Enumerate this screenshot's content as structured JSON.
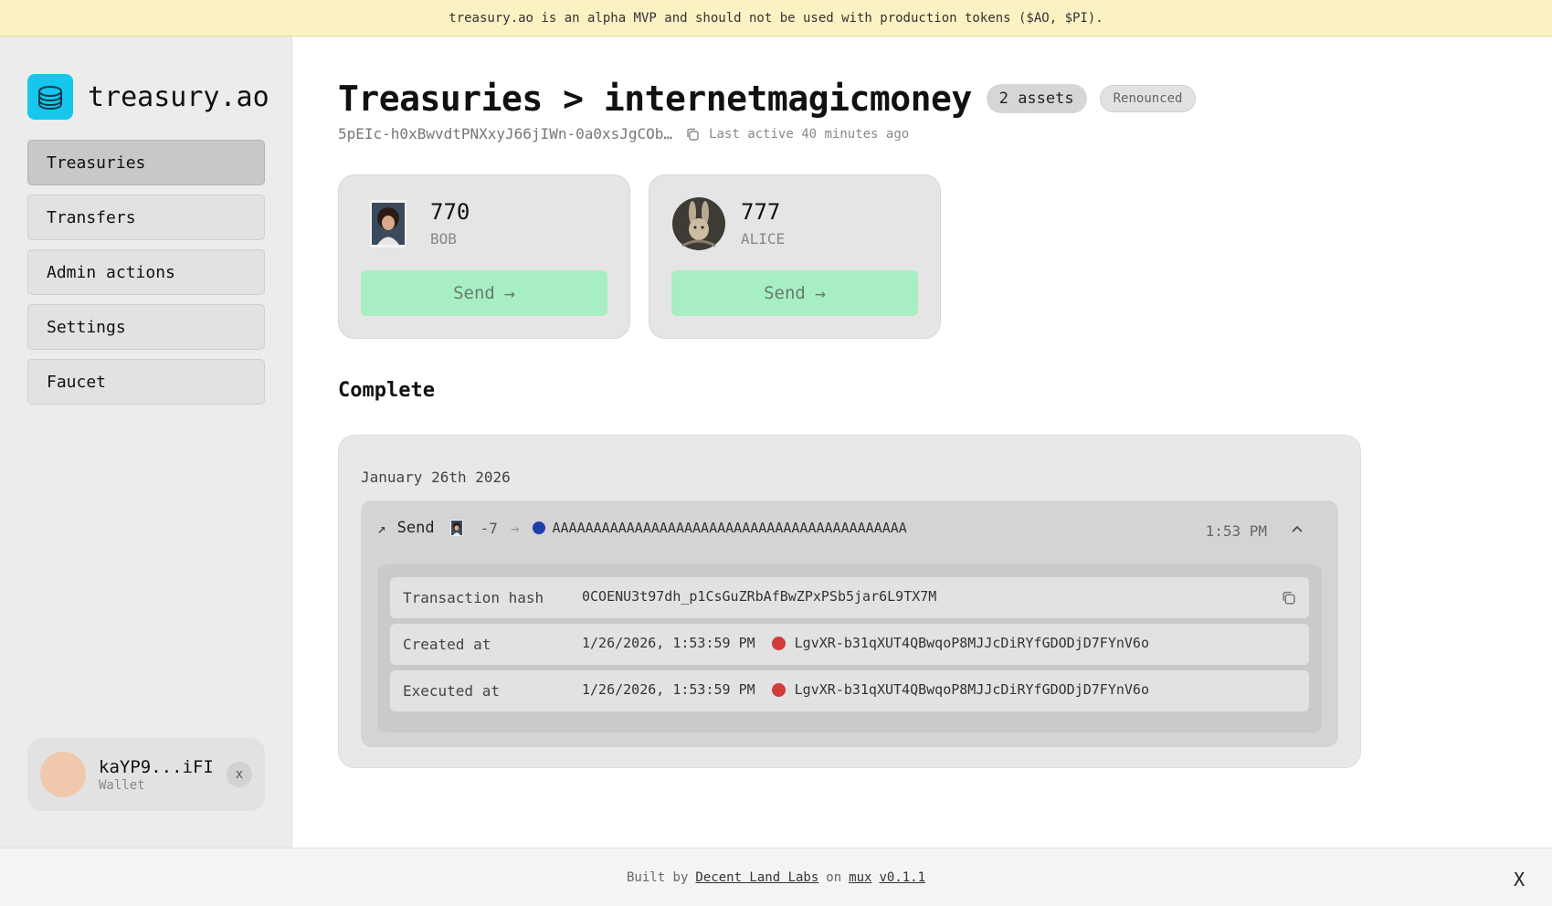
{
  "banner": {
    "text": "treasury.ao is an alpha MVP and should not be used with production tokens ($AO, $PI)."
  },
  "sidebar": {
    "brand": "treasury.ao",
    "nav": [
      "Treasuries",
      "Transfers",
      "Admin actions",
      "Settings",
      "Faucet"
    ],
    "active": "Treasuries",
    "wallet": {
      "address": "kaYP9...iFI",
      "label": "Wallet",
      "close": "x"
    }
  },
  "header": {
    "title": "Treasuries > internetmagicmoney",
    "assets_badge": "2 assets",
    "status_badge": "Renounced",
    "address": "5pEIc-h0xBwvdtPNXxyJ66jIWn-0a0xsJgCOb…",
    "last_active": "Last active 40 minutes ago"
  },
  "assets": [
    {
      "amount": "770",
      "ticker": "BOB",
      "action": "Send"
    },
    {
      "amount": "777",
      "ticker": "ALICE",
      "action": "Send"
    }
  ],
  "section": {
    "title": "Complete"
  },
  "history": {
    "date": "January 26th 2026",
    "tx": {
      "direction": "↗",
      "type": "Send",
      "amount": "-7",
      "arrow": "→",
      "destination": "AAAAAAAAAAAAAAAAAAAAAAAAAAAAAAAAAAAAAAAAAAA",
      "time": "1:53 PM",
      "details": {
        "hash_label": "Transaction hash",
        "hash": "0COENU3t97dh_p1CsGuZRbAfBwZPxPSb5jar6L9TX7M",
        "created_label": "Created at",
        "created_at": "1/26/2026, 1:53:59 PM",
        "created_by": "LgvXR-b31qXUT4QBwqoP8MJJcDiRYfGDODjD7FYnV6o",
        "executed_label": "Executed at",
        "executed_at": "1/26/2026, 1:53:59 PM",
        "executed_by": "LgvXR-b31qXUT4QBwqoP8MJJcDiRYfGDODjD7FYnV6o"
      }
    }
  },
  "footer": {
    "built_by": "Built by",
    "org": "Decent Land Labs",
    "on": "on",
    "platform": "mux",
    "version": "v0.1.1",
    "close": "X"
  }
}
